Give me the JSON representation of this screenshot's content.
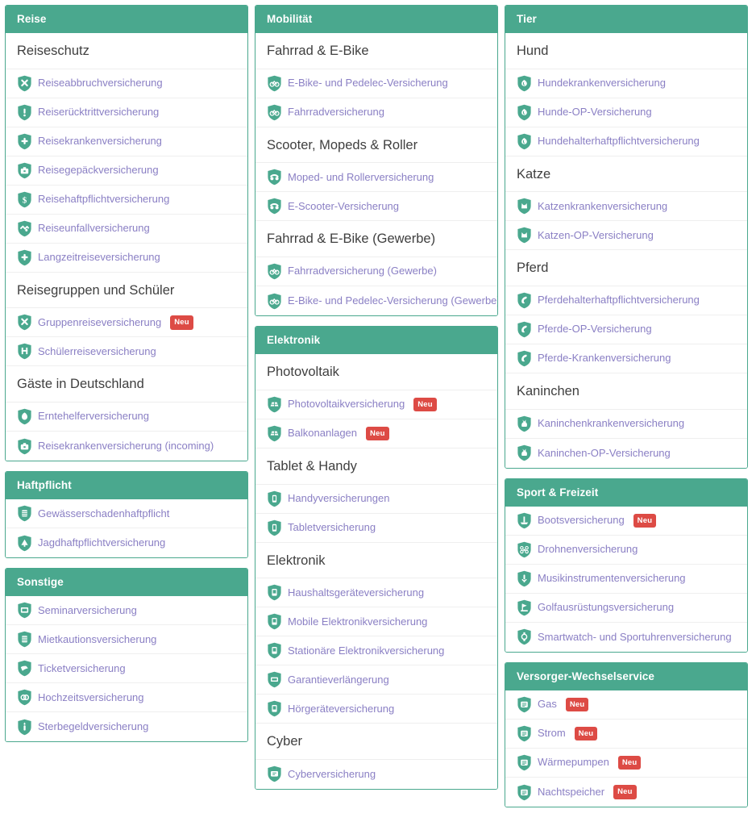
{
  "meta": {
    "accent_green": "#4aa88e",
    "link_purple": "#8a7fc4",
    "badge_red": "#dd4b45",
    "heading_gray": "#3f3f3f",
    "badge_label": "Neu"
  },
  "columns": [
    {
      "name": "column-left",
      "cards": [
        {
          "title": "Reise",
          "groups": [
            {
              "title": "Reiseschutz",
              "items": [
                {
                  "label": "Reiseabbruchversicherung",
                  "icon": "shield-x-icon",
                  "badge": null
                },
                {
                  "label": "Reiserücktrittversicherung",
                  "icon": "shield-exclamation-icon",
                  "badge": null
                },
                {
                  "label": "Reisekrankenversicherung",
                  "icon": "shield-plus-icon",
                  "badge": null
                },
                {
                  "label": "Reisegepäckversicherung",
                  "icon": "shield-suitcase-icon",
                  "badge": null
                },
                {
                  "label": "Reisehaftpflichtversicherung",
                  "icon": "shield-dollar-icon",
                  "badge": null
                },
                {
                  "label": "Reiseunfallversicherung",
                  "icon": "shield-crash-icon",
                  "badge": null
                },
                {
                  "label": "Langzeitreiseversicherung",
                  "icon": "shield-plus-icon",
                  "badge": null
                }
              ]
            },
            {
              "title": "Reisegruppen und Schüler",
              "items": [
                {
                  "label": "Gruppenreiseversicherung",
                  "icon": "shield-x-icon",
                  "badge": "Neu"
                },
                {
                  "label": "Schülerreiseversicherung",
                  "icon": "shield-school-icon",
                  "badge": null
                }
              ]
            },
            {
              "title": "Gäste in Deutschland",
              "items": [
                {
                  "label": "Erntehelferversicherung",
                  "icon": "shield-harvest-icon",
                  "badge": null
                },
                {
                  "label": "Reisekrankenversicherung (incoming)",
                  "icon": "shield-suitcase-icon",
                  "badge": null
                }
              ]
            }
          ]
        },
        {
          "title": "Haftpflicht",
          "groups": [
            {
              "title": null,
              "items": [
                {
                  "label": "Gewässerschadenhaftpflicht",
                  "icon": "shield-tank-icon",
                  "badge": null
                },
                {
                  "label": "Jagdhaftpflichtversicherung",
                  "icon": "shield-hunting-icon",
                  "badge": null
                }
              ]
            }
          ]
        },
        {
          "title": "Sonstige",
          "groups": [
            {
              "title": null,
              "items": [
                {
                  "label": "Seminarversicherung",
                  "icon": "shield-seminar-icon",
                  "badge": null
                },
                {
                  "label": "Mietkautionsversicherung",
                  "icon": "shield-deposit-icon",
                  "badge": null
                },
                {
                  "label": "Ticketversicherung",
                  "icon": "shield-ticket-icon",
                  "badge": null
                },
                {
                  "label": "Hochzeitsversicherung",
                  "icon": "shield-rings-icon",
                  "badge": null
                },
                {
                  "label": "Sterbegeldversicherung",
                  "icon": "shield-candle-icon",
                  "badge": null
                }
              ]
            }
          ]
        }
      ]
    },
    {
      "name": "column-middle",
      "cards": [
        {
          "title": "Mobilität",
          "groups": [
            {
              "title": "Fahrrad & E-Bike",
              "items": [
                {
                  "label": "E-Bike- und Pedelec-Versicherung",
                  "icon": "shield-bicycle-icon",
                  "badge": null
                },
                {
                  "label": "Fahrradversicherung",
                  "icon": "shield-bicycle-icon",
                  "badge": null
                }
              ]
            },
            {
              "title": "Scooter, Mopeds & Roller",
              "items": [
                {
                  "label": "Moped- und Rollerversicherung",
                  "icon": "shield-scooter-icon",
                  "badge": null
                },
                {
                  "label": "E-Scooter-Versicherung",
                  "icon": "shield-scooter-icon",
                  "badge": null
                }
              ]
            },
            {
              "title": "Fahrrad & E-Bike (Gewerbe)",
              "items": [
                {
                  "label": "Fahrradversicherung (Gewerbe)",
                  "icon": "shield-bicycle-icon",
                  "badge": null
                },
                {
                  "label": "E-Bike- und Pedelec-Versicherung (Gewerbe)",
                  "icon": "shield-bicycle-icon",
                  "badge": null
                }
              ]
            }
          ]
        },
        {
          "title": "Elektronik",
          "groups": [
            {
              "title": "Photovoltaik",
              "items": [
                {
                  "label": "Photovoltaikversicherung",
                  "icon": "shield-solar-icon",
                  "badge": "Neu"
                },
                {
                  "label": "Balkonanlagen",
                  "icon": "shield-solar-icon",
                  "badge": "Neu"
                }
              ]
            },
            {
              "title": "Tablet & Handy",
              "items": [
                {
                  "label": "Handyversicherungen",
                  "icon": "shield-phone-icon",
                  "badge": null
                },
                {
                  "label": "Tabletversicherung",
                  "icon": "shield-phone-icon",
                  "badge": null
                }
              ]
            },
            {
              "title": "Elektronik",
              "items": [
                {
                  "label": "Haushaltsgeräteversicherung",
                  "icon": "shield-appliance-icon",
                  "badge": null
                },
                {
                  "label": "Mobile Elektronikversicherung",
                  "icon": "shield-appliance-icon",
                  "badge": null
                },
                {
                  "label": "Stationäre Elektronikversicherung",
                  "icon": "shield-appliance-icon",
                  "badge": null
                },
                {
                  "label": "Garantieverlängerung",
                  "icon": "shield-warranty-icon",
                  "badge": null
                },
                {
                  "label": "Hörgeräteversicherung",
                  "icon": "shield-appliance-icon",
                  "badge": null
                }
              ]
            },
            {
              "title": "Cyber",
              "items": [
                {
                  "label": "Cyberversicherung",
                  "icon": "shield-cyber-icon",
                  "badge": null
                }
              ]
            }
          ]
        }
      ]
    },
    {
      "name": "column-right",
      "cards": [
        {
          "title": "Tier",
          "groups": [
            {
              "title": "Hund",
              "items": [
                {
                  "label": "Hundekrankenversicherung",
                  "icon": "shield-dog-icon",
                  "badge": null
                },
                {
                  "label": "Hunde-OP-Versicherung",
                  "icon": "shield-dog-icon",
                  "badge": null
                },
                {
                  "label": "Hundehalterhaftpflichtversicherung",
                  "icon": "shield-dog-icon",
                  "badge": null
                }
              ]
            },
            {
              "title": "Katze",
              "items": [
                {
                  "label": "Katzenkrankenversicherung",
                  "icon": "shield-cat-icon",
                  "badge": null
                },
                {
                  "label": "Katzen-OP-Versicherung",
                  "icon": "shield-cat-icon",
                  "badge": null
                }
              ]
            },
            {
              "title": "Pferd",
              "items": [
                {
                  "label": "Pferdehalterhaftpflichtversicherung",
                  "icon": "shield-horse-icon",
                  "badge": null
                },
                {
                  "label": "Pferde-OP-Versicherung",
                  "icon": "shield-horse-icon",
                  "badge": null
                },
                {
                  "label": "Pferde-Krankenversicherung",
                  "icon": "shield-horse-icon",
                  "badge": null
                }
              ]
            },
            {
              "title": "Kaninchen",
              "items": [
                {
                  "label": "Kaninchenkrankenversicherung",
                  "icon": "shield-rabbit-icon",
                  "badge": null
                },
                {
                  "label": "Kaninchen-OP-Versicherung",
                  "icon": "shield-rabbit-icon",
                  "badge": null
                }
              ]
            }
          ]
        },
        {
          "title": "Sport & Freizeit",
          "groups": [
            {
              "title": null,
              "items": [
                {
                  "label": "Bootsversicherung",
                  "icon": "shield-boat-icon",
                  "badge": "Neu"
                },
                {
                  "label": "Drohnenversicherung",
                  "icon": "shield-drone-icon",
                  "badge": null
                },
                {
                  "label": "Musikinstrumentenversicherung",
                  "icon": "shield-music-icon",
                  "badge": null
                },
                {
                  "label": "Golfausrüstungsversicherung",
                  "icon": "shield-golf-icon",
                  "badge": null
                },
                {
                  "label": "Smartwatch- und Sportuhrenversicherung",
                  "icon": "shield-watch-icon",
                  "badge": null
                }
              ]
            }
          ]
        },
        {
          "title": "Versorger-Wechselservice",
          "groups": [
            {
              "title": null,
              "items": [
                {
                  "label": "Gas",
                  "icon": "shield-utility-icon",
                  "badge": "Neu"
                },
                {
                  "label": "Strom",
                  "icon": "shield-utility-icon",
                  "badge": "Neu"
                },
                {
                  "label": "Wärmepumpen",
                  "icon": "shield-utility-icon",
                  "badge": "Neu"
                },
                {
                  "label": "Nachtspeicher",
                  "icon": "shield-utility-icon",
                  "badge": "Neu"
                }
              ]
            }
          ]
        }
      ]
    }
  ]
}
